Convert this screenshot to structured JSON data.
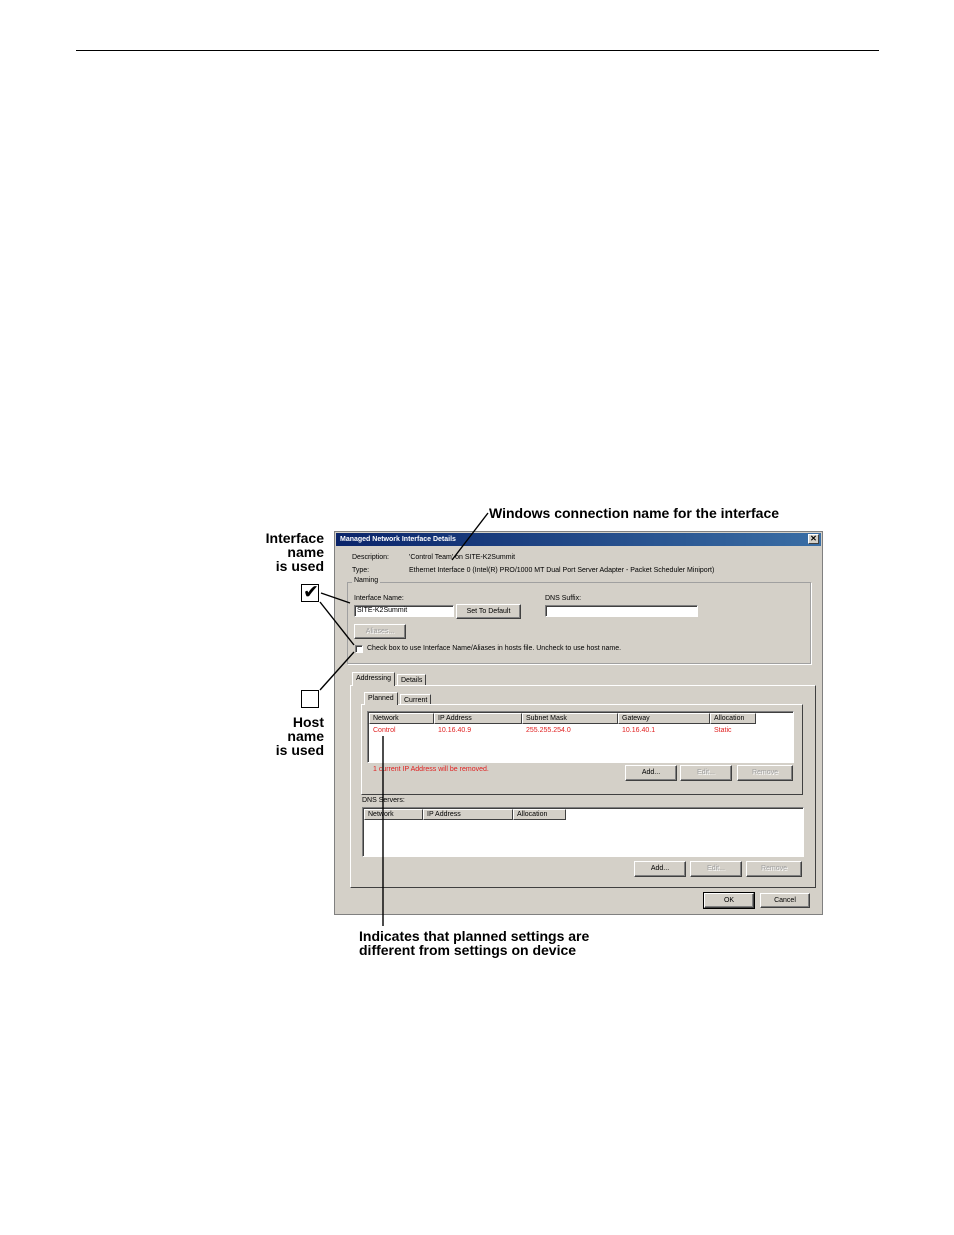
{
  "callouts": {
    "interface_name_used": [
      "Interface",
      "name",
      "is used"
    ],
    "host_name_used": [
      "Host",
      "name",
      "is used"
    ],
    "windows_connection": "Windows connection name for the interface",
    "planned_differs": [
      "Indicates that planned settings are",
      "different from settings on device"
    ],
    "checked_glyph": "✔"
  },
  "dialog": {
    "title": "Managed Network Interface Details",
    "close_glyph": "✕",
    "description_label": "Description:",
    "description_value": "'Control Team' on SITE-K2Summit",
    "type_label": "Type:",
    "type_value": "Ethernet Interface 0 (Intel(R) PRO/1000 MT Dual Port Server Adapter - Packet Scheduler Miniport)",
    "naming": {
      "group_title": "Naming",
      "interface_name_label": "Interface Name:",
      "interface_name_value": "SITE-K2Summit",
      "set_default_label": "Set To Default",
      "dns_suffix_label": "DNS Suffix:",
      "dns_suffix_value": "",
      "aliases_label": "Aliases...",
      "hosts_checkbox_label": "Check box to use Interface Name/Aliases in hosts file. Uncheck to use host name."
    },
    "tabs": {
      "addressing": "Addressing",
      "details": "Details"
    },
    "subtabs": {
      "planned": "Planned",
      "current": "Current"
    },
    "ip_table": {
      "headers": [
        "Network",
        "IP Address",
        "Subnet Mask",
        "Gateway",
        "Allocation"
      ],
      "rows": [
        [
          "Control",
          "10.16.40.9",
          "255.255.254.0",
          "10.16.40.1",
          "Static"
        ]
      ],
      "warning": "1 current IP Address will be removed.",
      "add_label": "Add...",
      "edit_label": "Edit...",
      "remove_label": "Remove"
    },
    "dns": {
      "label": "DNS Servers:",
      "headers": [
        "Network",
        "IP Address",
        "Allocation"
      ],
      "add_label": "Add...",
      "edit_label": "Edit...",
      "remove_label": "Remove"
    },
    "ok_label": "OK",
    "cancel_label": "Cancel"
  }
}
